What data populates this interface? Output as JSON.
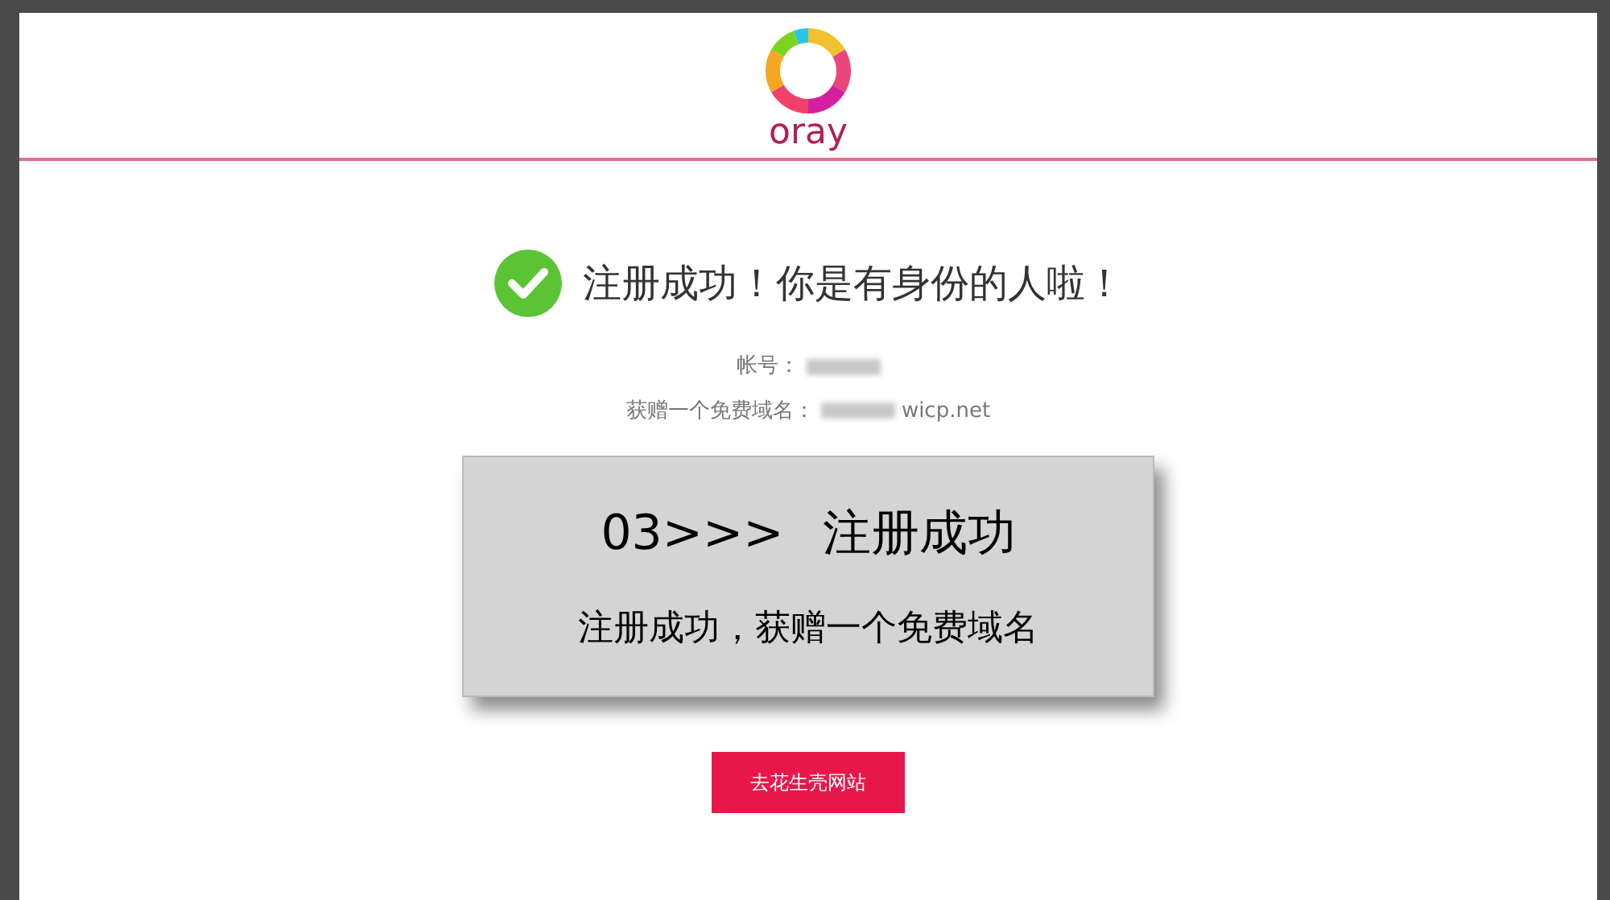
{
  "header": {
    "logo_text": "oray"
  },
  "success": {
    "title": "注册成功！你是有身份的人啦！"
  },
  "details": [
    {
      "label": "帐号：",
      "redacted": true
    },
    {
      "label": "获赠一个免费域名：",
      "redacted": true,
      "value": "wicp.net"
    }
  ],
  "step_card": {
    "step": "03>>>",
    "title": "注册成功",
    "subtitle": "注册成功，获赠一个免费域名"
  },
  "button": {
    "label": "去花生壳网站"
  }
}
